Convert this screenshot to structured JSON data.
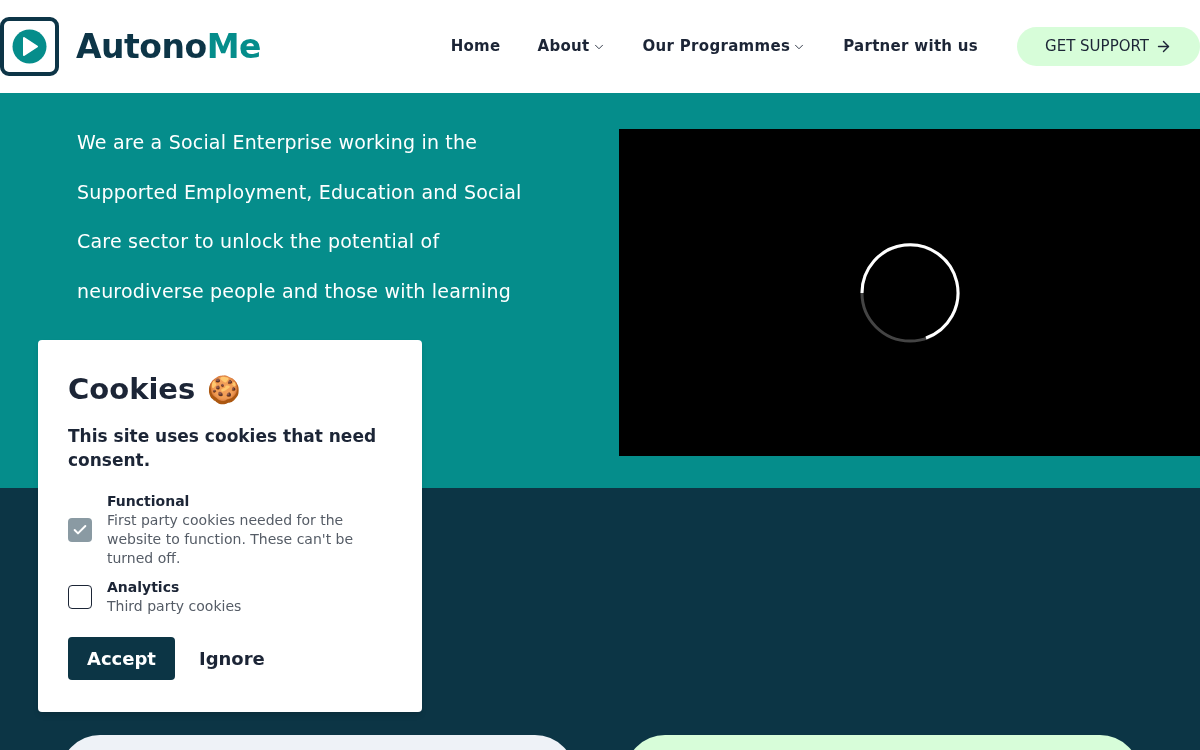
{
  "header": {
    "logo": {
      "part_1": "Autono",
      "part_2": "Me"
    },
    "nav": [
      {
        "label": "Home",
        "has_dropdown": false
      },
      {
        "label": "About",
        "has_dropdown": true
      },
      {
        "label": "Our Programmes",
        "has_dropdown": true
      },
      {
        "label": "Partner with us",
        "has_dropdown": false
      }
    ],
    "cta": "GET SUPPORT"
  },
  "hero": {
    "text": "We are a Social Enterprise working in the Supported Employment, Education and Social Care sector to unlock the potential of neurodiverse people and those with learning",
    "video": {
      "loading": true
    }
  },
  "cookie_dialog": {
    "title": "Cookies",
    "emoji": "🍪",
    "subtitle": "This site uses cookies that need consent.",
    "options": [
      {
        "label": "Functional",
        "description": "First party cookies needed for the website to function. These can't be turned off.",
        "checked": true,
        "disabled": true
      },
      {
        "label": "Analytics",
        "description": "Third party cookies",
        "checked": false,
        "disabled": false
      }
    ],
    "buttons": [
      {
        "label": "Accept",
        "kind": "primary"
      },
      {
        "label": "Ignore",
        "kind": "text"
      }
    ]
  }
}
